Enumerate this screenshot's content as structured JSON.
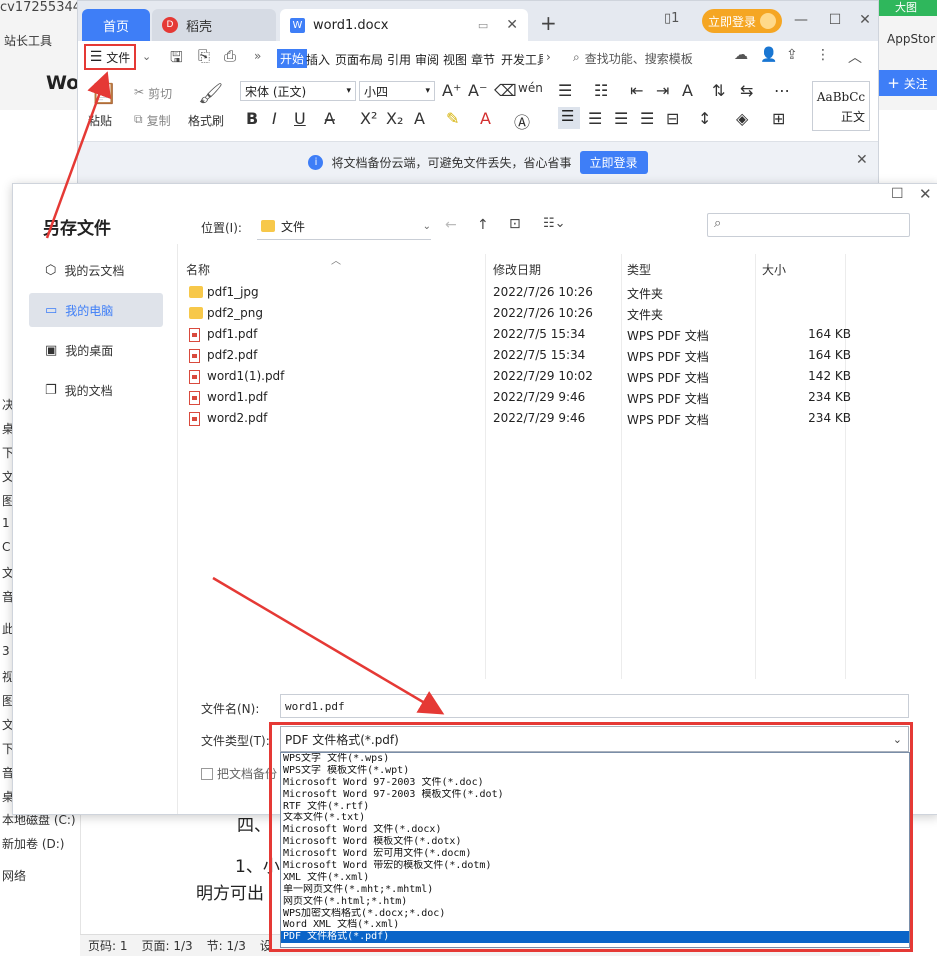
{
  "background": {
    "top_left_text": "cv17255344",
    "bookmark_item": "站长工具",
    "page_heading_partial": "Wo",
    "appstore": "AppStor",
    "top_right_badge": "大图",
    "follow_button": "关注",
    "left_items": [
      "决",
      "桌",
      "下",
      "文",
      "图",
      "1",
      "C",
      "文",
      "音",
      "此",
      "3",
      "视",
      "图",
      "文",
      "下",
      "音",
      "桌"
    ],
    "drive_c": "本地磁盘 (C:)",
    "drive_d": "新加卷 (D:)",
    "network": "网络",
    "doc_heading": "四、",
    "doc_line1": "1、小",
    "doc_line2": "明方可出"
  },
  "wps": {
    "tabs": {
      "home": "首页",
      "daoke": "稻壳",
      "doc": "word1.docx"
    },
    "login_button": "立即登录",
    "file_menu": "文件",
    "menu_items": [
      "开始",
      "插入",
      "页面布局",
      "引用",
      "审阅",
      "视图",
      "章节",
      "开发工具"
    ],
    "search_placeholder": "查找功能、搜索模板",
    "ribbon": {
      "paste": "粘贴",
      "cut": "剪切",
      "copy": "复制",
      "format_painter": "格式刷",
      "font": "宋体 (正文)",
      "size": "小四",
      "style_preview": "AaBbCc",
      "style_name": "正文"
    },
    "notice_text": "将文档备份云端，可避免文件丢失，省心省事",
    "notice_button": "立即登录"
  },
  "dialog": {
    "title": "另存文件",
    "location_label": "位置(I):",
    "location_value": "文件",
    "nav": [
      "我的云文档",
      "我的电脑",
      "我的桌面",
      "我的文档"
    ],
    "columns": [
      "名称",
      "修改日期",
      "类型",
      "大小"
    ],
    "files": [
      {
        "name": "pdf1_jpg",
        "date": "2022/7/26 10:26",
        "type": "文件夹",
        "size": "",
        "kind": "folder"
      },
      {
        "name": "pdf2_png",
        "date": "2022/7/26 10:26",
        "type": "文件夹",
        "size": "",
        "kind": "folder"
      },
      {
        "name": "pdf1.pdf",
        "date": "2022/7/5 15:34",
        "type": "WPS PDF 文档",
        "size": "164 KB",
        "kind": "pdf"
      },
      {
        "name": "pdf2.pdf",
        "date": "2022/7/5 15:34",
        "type": "WPS PDF 文档",
        "size": "164 KB",
        "kind": "pdf"
      },
      {
        "name": "word1(1).pdf",
        "date": "2022/7/29 10:02",
        "type": "WPS PDF 文档",
        "size": "142 KB",
        "kind": "pdf"
      },
      {
        "name": "word1.pdf",
        "date": "2022/7/29 9:46",
        "type": "WPS PDF 文档",
        "size": "234 KB",
        "kind": "pdf"
      },
      {
        "name": "word2.pdf",
        "date": "2022/7/29 9:46",
        "type": "WPS PDF 文档",
        "size": "234 KB",
        "kind": "pdf"
      }
    ],
    "filename_label": "文件名(N):",
    "filename_value": "word1.pdf",
    "filetype_label": "文件类型(T):",
    "filetype_value": "PDF 文件格式(*.pdf)",
    "backup_checkbox": "把文档备份",
    "filetype_options": [
      "WPS文字 文件(*.wps)",
      "WPS文字 模板文件(*.wpt)",
      "Microsoft Word 97-2003 文件(*.doc)",
      "Microsoft Word 97-2003 模板文件(*.dot)",
      "RTF 文件(*.rtf)",
      "文本文件(*.txt)",
      "Microsoft Word 文件(*.docx)",
      "Microsoft Word 模板文件(*.dotx)",
      "Microsoft Word 宏可用文件(*.docm)",
      "Microsoft Word 带宏的模板文件(*.dotm)",
      "XML 文件(*.xml)",
      "单一网页文件(*.mht;*.mhtml)",
      "网页文件(*.html;*.htm)",
      "WPS加密文档格式(*.docx;*.doc)",
      "Word XML 文档(*.xml)",
      "PDF 文件格式(*.pdf)"
    ],
    "selected_option_index": 15
  },
  "statusbar": {
    "page": "页码: 1",
    "pages": "页面: 1/3",
    "section": "节: 1/3",
    "settings": "设"
  },
  "colors": {
    "accent": "#3e7ef7",
    "highlight_red": "#e53935",
    "selected_option": "#0a64c8",
    "login_orange": "#f5a623"
  }
}
